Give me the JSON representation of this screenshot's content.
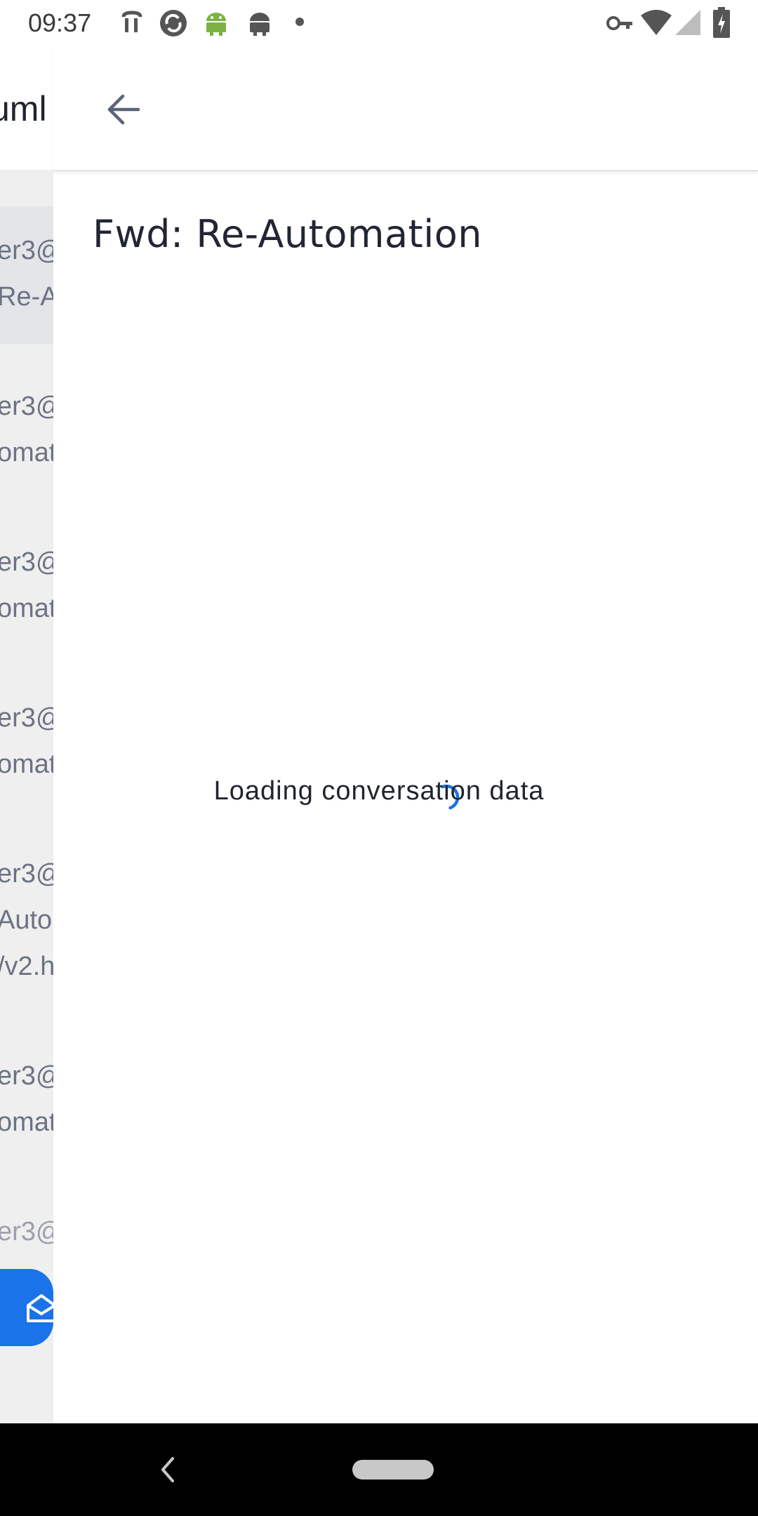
{
  "status_bar": {
    "time": "09:37",
    "icons_left": [
      "accessibility-icon",
      "sync-icon",
      "android-icon",
      "android-debug-icon",
      "dot-icon"
    ],
    "icons_right": [
      "vpn-key-icon",
      "wifi-icon",
      "signal-icon",
      "battery-charging-icon"
    ]
  },
  "background_list": {
    "header_title": "uml",
    "items": [
      {
        "line1": "er3@",
        "line2": "Re-Au"
      },
      {
        "line1": "er3@",
        "line2": "omat"
      },
      {
        "line1": "er3@",
        "line2": "omat"
      },
      {
        "line1": "er3@",
        "line2": "omat"
      },
      {
        "line1": "er3@",
        "line2": "Auto",
        "line3": "/v2.h"
      },
      {
        "line1": "er3@",
        "line2": "omat"
      },
      {
        "line1": "er3@"
      }
    ],
    "fab_icon": "mail-compose-icon"
  },
  "conversation": {
    "subject": "Fwd:  Re-Automation",
    "loading_text": "Loading conversation data"
  },
  "colors": {
    "accent": "#1a73e8",
    "text_dark": "#1f2430",
    "text_muted": "#6b7384",
    "list_bg": "#efefef",
    "selected_bg": "#e4e5e9"
  }
}
